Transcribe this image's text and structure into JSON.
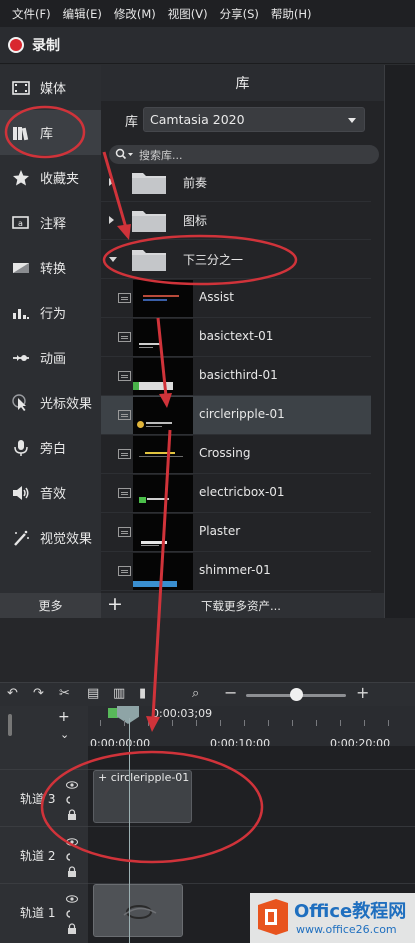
{
  "menu": [
    "文件(F)",
    "编辑(E)",
    "修改(M)",
    "视图(V)",
    "分享(S)",
    "帮助(H)"
  ],
  "record_label": "录制",
  "sidebar": {
    "items": [
      {
        "label": "媒体",
        "icon": "film-icon"
      },
      {
        "label": "库",
        "icon": "library-icon",
        "active": true
      },
      {
        "label": "收藏夹",
        "icon": "star-icon"
      },
      {
        "label": "注释",
        "icon": "annotation-icon"
      },
      {
        "label": "转换",
        "icon": "transition-icon"
      },
      {
        "label": "行为",
        "icon": "behavior-icon"
      },
      {
        "label": "动画",
        "icon": "animation-icon"
      },
      {
        "label": "光标效果",
        "icon": "cursor-effect-icon"
      },
      {
        "label": "旁白",
        "icon": "microphone-icon"
      },
      {
        "label": "音效",
        "icon": "speaker-icon"
      },
      {
        "label": "视觉效果",
        "icon": "magic-wand-icon"
      }
    ],
    "more_label": "更多"
  },
  "library": {
    "title": "库",
    "select_label": "库",
    "select_value": "Camtasia 2020",
    "search_placeholder": "搜索库...",
    "folders": [
      "前奏",
      "图标",
      "下三分之一"
    ],
    "items": [
      "Assist",
      "basictext-01",
      "basicthird-01",
      "circleripple-01",
      "Crossing",
      "electricbox-01",
      "Plaster",
      "shimmer-01"
    ],
    "selected_item": "circleripple-01",
    "download_more": "下载更多资产..."
  },
  "timeline": {
    "playhead_time": "0:00:03;09",
    "ruler_labels": [
      "0:00:00;00",
      "0:00:10;00",
      "0:00:20;00"
    ],
    "tracks": [
      "轨道 3",
      "轨道 2",
      "轨道 1"
    ],
    "clip_label": "circleripple-01"
  },
  "watermark": {
    "brand": "Office教程网",
    "url": "www.office26.com"
  },
  "colors": {
    "record": "#d9272e",
    "annotation": "#d0333a",
    "watermark": "#1f6fbf"
  }
}
